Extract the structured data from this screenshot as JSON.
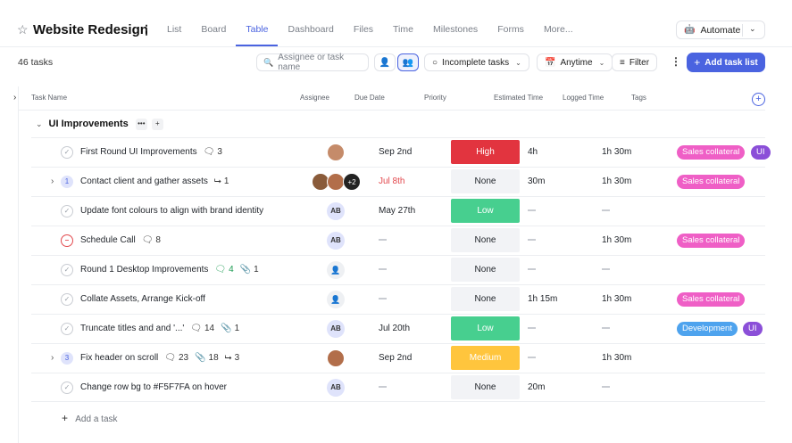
{
  "header": {
    "title": "Website Redesign",
    "tabs": [
      "List",
      "Board",
      "Table",
      "Dashboard",
      "Files",
      "Time",
      "Milestones",
      "Forms",
      "More..."
    ],
    "active_tab": "Table",
    "automate_label": "Automate"
  },
  "toolbar": {
    "task_count": "46 tasks",
    "search_placeholder": "Assignee or task name",
    "status_filter": "Incomplete tasks",
    "date_filter": "Anytime",
    "filter_label": "Filter",
    "add_task_label": "Add task list"
  },
  "columns": {
    "task_name": "Task Name",
    "assignee": "Assignee",
    "due_date": "Due Date",
    "priority": "Priority",
    "estimated_time": "Estimated Time",
    "logged_time": "Logged Time",
    "tags": "Tags"
  },
  "group": {
    "name": "UI Improvements",
    "more": "•••",
    "add": "+"
  },
  "colors": {
    "accent": "#4a63e0",
    "high": "#e2343f",
    "low": "#47cf8f",
    "medium": "#ffc53d",
    "none_bg": "#f2f3f6",
    "sales_collateral": "#ef5fc6",
    "development": "#4ea3ee",
    "ui": "#8b4fd8"
  },
  "rows": [
    {
      "name": "First Round UI Improvements",
      "comments": "3",
      "due": "Sep 2nd",
      "priority": "High",
      "estimated": "4h",
      "logged": "1h 30m",
      "tags": [
        "Sales collateral",
        "UI"
      ]
    },
    {
      "name": "Contact client and gather assets",
      "subtasks_badge": "1",
      "subtasks": "1",
      "assignee_more": "+2",
      "due": "Jul 8th",
      "priority": "None",
      "estimated": "30m",
      "logged": "1h 30m",
      "tags": [
        "Sales collateral"
      ]
    },
    {
      "name": "Update font colours to align with brand identity",
      "assignee": "AB",
      "due": "May 27th",
      "priority": "Low",
      "tags": []
    },
    {
      "name": "Schedule Call",
      "comments": "8",
      "assignee": "AB",
      "priority": "None",
      "logged": "1h 30m",
      "tags": [
        "Sales collateral"
      ]
    },
    {
      "name": "Round 1 Desktop Improvements",
      "comments": "4",
      "attachments": "1",
      "priority": "None",
      "tags": []
    },
    {
      "name": "Collate Assets, Arrange Kick-off",
      "priority": "None",
      "estimated": "1h 15m",
      "logged": "1h 30m",
      "tags": [
        "Sales collateral"
      ]
    },
    {
      "name": "Truncate titles and and '...'",
      "comments": "14",
      "attachments": "1",
      "assignee": "AB",
      "due": "Jul 20th",
      "priority": "Low",
      "tags": [
        "Development",
        "UI"
      ]
    },
    {
      "name": "Fix header on scroll",
      "subtasks_badge": "3",
      "comments": "23",
      "attachments": "18",
      "subtasks": "3",
      "due": "Sep 2nd",
      "priority": "Medium",
      "logged": "1h 30m",
      "tags": []
    },
    {
      "name": "Change row bg to #F5F7FA on hover",
      "assignee": "AB",
      "priority": "None",
      "estimated": "20m",
      "tags": []
    }
  ],
  "add_row_label": "Add a task"
}
